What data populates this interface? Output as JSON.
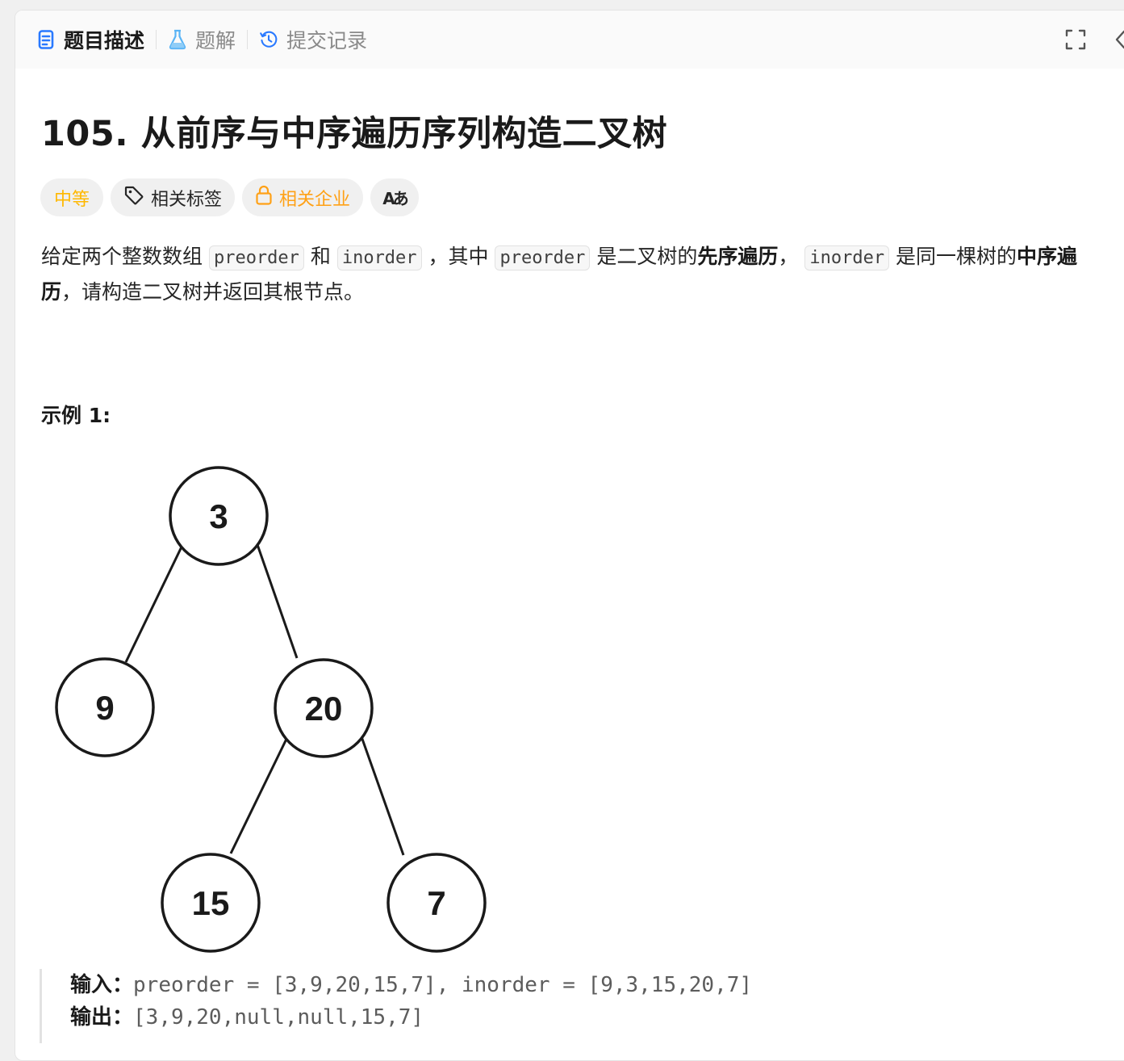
{
  "tabs": [
    {
      "label": "题目描述",
      "icon": "description-icon",
      "active": true
    },
    {
      "label": "题解",
      "icon": "flask-icon",
      "active": false
    },
    {
      "label": "提交记录",
      "icon": "history-icon",
      "active": false
    }
  ],
  "problem": {
    "title": "105. 从前序与中序遍历序列构造二叉树",
    "difficulty": "中等",
    "tags": {
      "related_tags": "相关标签",
      "related_companies": "相关企业",
      "translate_icon": "Aあ"
    },
    "description": {
      "p1": "给定两个整数数组 ",
      "code1": "preorder",
      "p2": " 和 ",
      "code2": "inorder",
      "p3": " ，其中 ",
      "code3": "preorder",
      "p4": " 是二叉树的",
      "b1": "先序遍历",
      "p5": "， ",
      "code4": "inorder",
      "p6": " 是同一棵树的",
      "b2": "中序遍历",
      "p7": "，请构造二叉树并返回其根节点。"
    }
  },
  "example1": {
    "title": "示例 1:",
    "tree_nodes": [
      "3",
      "9",
      "20",
      "15",
      "7"
    ],
    "input_label": "输入：",
    "input_value": "preorder = [3,9,20,15,7], inorder = [9,3,15,20,7]",
    "output_label": "输出：",
    "output_value": "[3,9,20,null,null,15,7]"
  },
  "colors": {
    "difficulty_medium": "#ffb800",
    "company_tag": "#ffa116",
    "description_icon": "#2979ff",
    "flask_icon": "#5ab4f5",
    "history_icon": "#2979ff"
  }
}
